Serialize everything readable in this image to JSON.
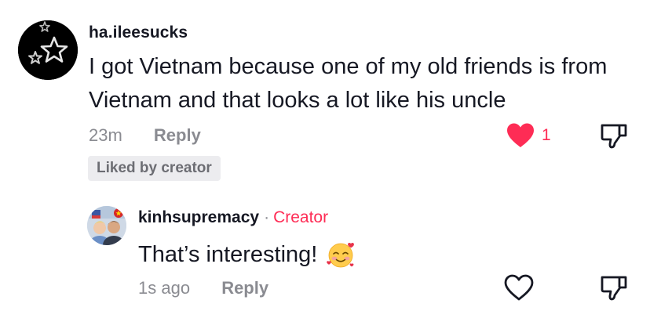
{
  "comment": {
    "username": "ha.ileesucks",
    "text": "I got Vietnam because one of my old friends is from Vietnam and that looks a lot like his uncle",
    "time": "23m",
    "reply_label": "Reply",
    "like_count": "1",
    "liked": true,
    "liked_by_creator_label": "Liked by creator",
    "avatar_icon": "star-avatar-icon"
  },
  "reply": {
    "username": "kinhsupremacy",
    "separator": "·",
    "creator_label": "Creator",
    "text": "That’s interesting!",
    "emoji": "smiling-face-with-hearts",
    "time": "1s ago",
    "reply_label": "Reply",
    "liked": false
  },
  "colors": {
    "accent": "#fe2c55",
    "text_primary": "#161823",
    "text_secondary": "#8a8b91",
    "badge_bg": "#ececef"
  }
}
